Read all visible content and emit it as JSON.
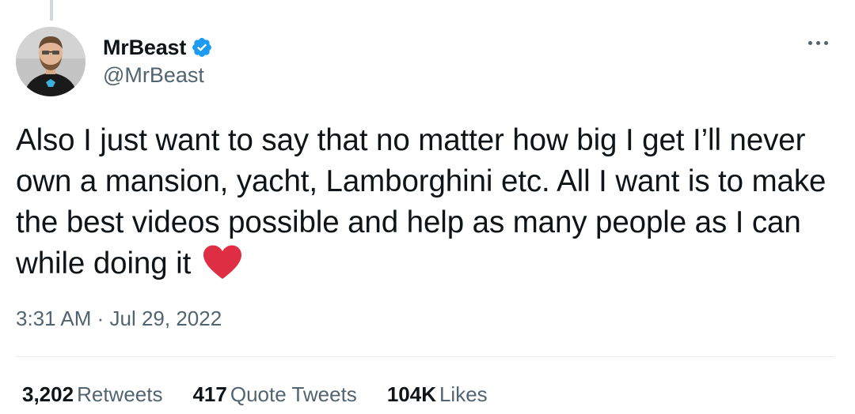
{
  "author": {
    "display_name": "MrBeast",
    "handle": "@MrBeast",
    "verified": true,
    "verified_color": "#1d9bf0"
  },
  "icons": {
    "avatar": "profile-photo",
    "verified": "verified-badge-icon",
    "more": "more-options-icon",
    "emoji": "red-heart-emoji"
  },
  "tweet": {
    "text": "Also I just want to say that no matter how big I get I’ll never own a mansion, yacht, Lamborghini etc. All I want is to make the best videos possible and help as many people as I can while doing it",
    "emoji": "❤️",
    "timestamp": "3:31 AM · Jul 29, 2022"
  },
  "stats": [
    {
      "count": "3,202",
      "label": "Retweets"
    },
    {
      "count": "417",
      "label": "Quote Tweets"
    },
    {
      "count": "104K",
      "label": "Likes"
    }
  ],
  "colors": {
    "text": "#0f1419",
    "secondary": "#536471",
    "heart": "#e0245e"
  }
}
